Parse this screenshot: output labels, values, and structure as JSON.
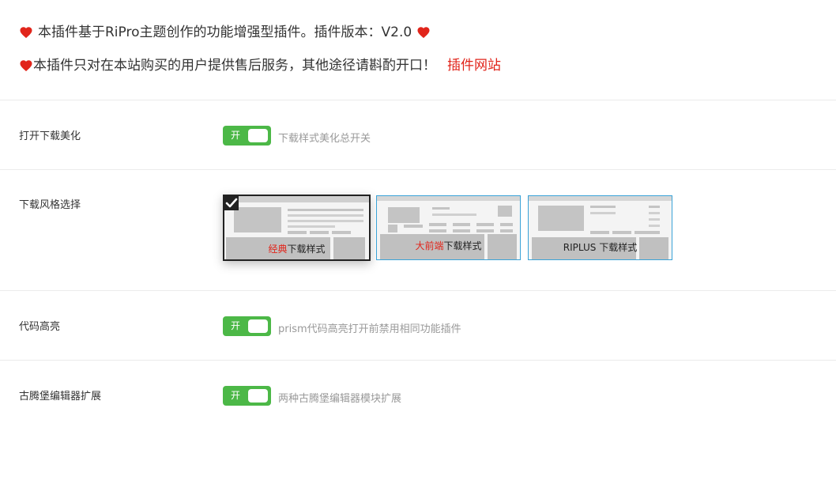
{
  "notice": {
    "line1_text": "本插件基于RiPro主题创作的功能增强型插件。插件版本：V2.0",
    "line2_text": "本插件只对在本站购买的用户提供售后服务，其他途径请斟酌开口！",
    "line2_link": "插件网站",
    "heart_color": "#e1251b"
  },
  "settings": {
    "download_beautify": {
      "label": "打开下载美化",
      "toggle_text": "开",
      "enabled": true,
      "description": "下载样式美化总开关"
    },
    "download_style": {
      "label": "下载风格选择",
      "selected_index": 0,
      "options": [
        {
          "caption_accent": "经典",
          "caption_rest": "下载样式"
        },
        {
          "caption_accent": "大前端",
          "caption_rest": "下载样式"
        },
        {
          "caption_accent": "",
          "caption_rest": "RIPLUS 下载样式"
        }
      ]
    },
    "code_highlight": {
      "label": "代码高亮",
      "toggle_text": "开",
      "enabled": true,
      "description": "prism代码高亮打开前禁用相同功能插件"
    },
    "gutenberg_ext": {
      "label": "古腾堡编辑器扩展",
      "toggle_text": "开",
      "enabled": true,
      "description": "两种古腾堡编辑器模块扩展"
    }
  },
  "colors": {
    "toggle_on": "#4cb847",
    "accent_red": "#e1251b",
    "option_border": "#3aa3d8"
  }
}
